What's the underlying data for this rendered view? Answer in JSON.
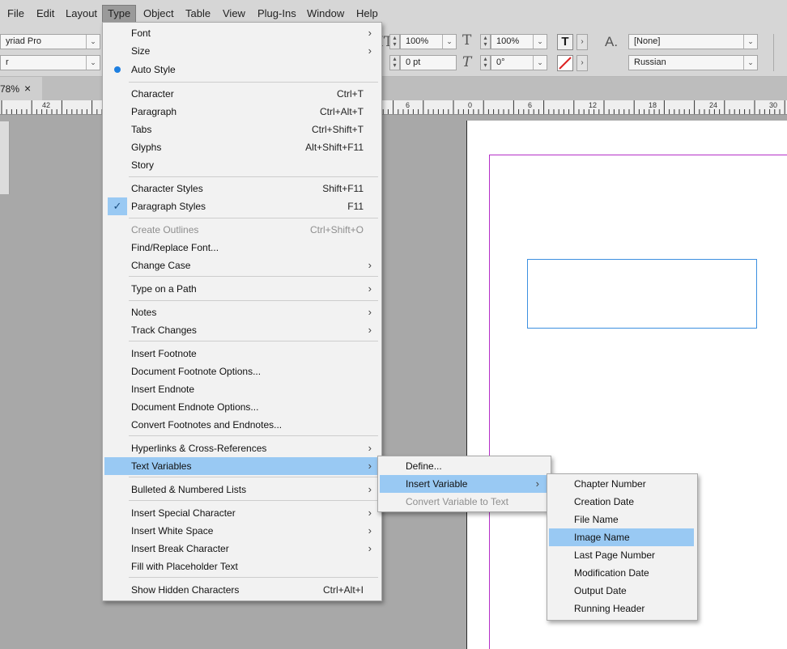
{
  "menubar": [
    "File",
    "Edit",
    "Layout",
    "Type",
    "Object",
    "Table",
    "View",
    "Plug-Ins",
    "Window",
    "Help"
  ],
  "control": {
    "font_family": "yriad Pro",
    "font_style": "r",
    "vscale": "100%",
    "hscale": "100%",
    "baseline": "0 pt",
    "skew": "0°",
    "char_style": "[None]",
    "language": "Russian"
  },
  "tab": {
    "zoom": "78%",
    "close": "×"
  },
  "ruler": {
    "labels": [
      "42",
      "6",
      "0",
      "6",
      "12",
      "18",
      "24",
      "30"
    ]
  },
  "type_menu": {
    "items": [
      {
        "label": "Font",
        "shortcut": "",
        "sub": true
      },
      {
        "label": "Size",
        "shortcut": "",
        "sub": true
      },
      {
        "label": "Auto Style",
        "shortcut": "",
        "sub": false,
        "mark": "dot"
      },
      {
        "label": "Character",
        "shortcut": "Ctrl+T",
        "sub": false
      },
      {
        "label": "Paragraph",
        "shortcut": "Ctrl+Alt+T",
        "sub": false
      },
      {
        "label": "Tabs",
        "shortcut": "Ctrl+Shift+T",
        "sub": false
      },
      {
        "label": "Glyphs",
        "shortcut": "Alt+Shift+F11",
        "sub": false
      },
      {
        "label": "Story",
        "shortcut": "",
        "sub": false
      },
      {
        "label": "Character Styles",
        "shortcut": "Shift+F11",
        "sub": false
      },
      {
        "label": "Paragraph Styles",
        "shortcut": "F11",
        "sub": false,
        "mark": "check"
      },
      {
        "label": "Create Outlines",
        "shortcut": "Ctrl+Shift+O",
        "sub": false,
        "disabled": true
      },
      {
        "label": "Find/Replace Font...",
        "shortcut": "",
        "sub": false
      },
      {
        "label": "Change Case",
        "shortcut": "",
        "sub": true
      },
      {
        "label": "Type on a Path",
        "shortcut": "",
        "sub": true
      },
      {
        "label": "Notes",
        "shortcut": "",
        "sub": true
      },
      {
        "label": "Track Changes",
        "shortcut": "",
        "sub": true
      },
      {
        "label": "Insert Footnote",
        "shortcut": "",
        "sub": false
      },
      {
        "label": "Document Footnote Options...",
        "shortcut": "",
        "sub": false
      },
      {
        "label": "Insert Endnote",
        "shortcut": "",
        "sub": false
      },
      {
        "label": "Document Endnote Options...",
        "shortcut": "",
        "sub": false
      },
      {
        "label": "Convert Footnotes and Endnotes...",
        "shortcut": "",
        "sub": false
      },
      {
        "label": "Hyperlinks & Cross-References",
        "shortcut": "",
        "sub": true
      },
      {
        "label": "Text Variables",
        "shortcut": "",
        "sub": true,
        "highlighted": true
      },
      {
        "label": "Bulleted & Numbered Lists",
        "shortcut": "",
        "sub": true
      },
      {
        "label": "Insert Special Character",
        "shortcut": "",
        "sub": true
      },
      {
        "label": "Insert White Space",
        "shortcut": "",
        "sub": true
      },
      {
        "label": "Insert Break Character",
        "shortcut": "",
        "sub": true
      },
      {
        "label": "Fill with Placeholder Text",
        "shortcut": "",
        "sub": false
      },
      {
        "label": "Show Hidden Characters",
        "shortcut": "Ctrl+Alt+I",
        "sub": false
      }
    ]
  },
  "text_variables_menu": {
    "items": [
      {
        "label": "Define...",
        "sub": false
      },
      {
        "label": "Insert Variable",
        "sub": true,
        "highlighted": true
      },
      {
        "label": "Convert Variable to Text",
        "sub": false,
        "disabled": true
      }
    ]
  },
  "insert_variable_menu": {
    "items": [
      {
        "label": "Chapter Number"
      },
      {
        "label": "Creation Date"
      },
      {
        "label": "File Name"
      },
      {
        "label": "Image Name",
        "highlighted": true
      },
      {
        "label": "Last Page Number"
      },
      {
        "label": "Modification Date"
      },
      {
        "label": "Output Date"
      },
      {
        "label": "Running Header"
      }
    ]
  },
  "colors": {
    "highlight": "#99c9f3",
    "margin_guide": "#b52fc7",
    "frame_edge": "#3c8fe0",
    "bullet": "#1e7fe0"
  },
  "icons": [
    "dropdown-arrow-icon",
    "chevron-right-icon",
    "check-icon",
    "bullet-dot-icon",
    "vertical-scale-icon",
    "horizontal-scale-icon",
    "baseline-shift-icon",
    "skew-icon",
    "text-fill-icon",
    "text-stroke-none-icon",
    "char-style-icon",
    "close-icon"
  ]
}
